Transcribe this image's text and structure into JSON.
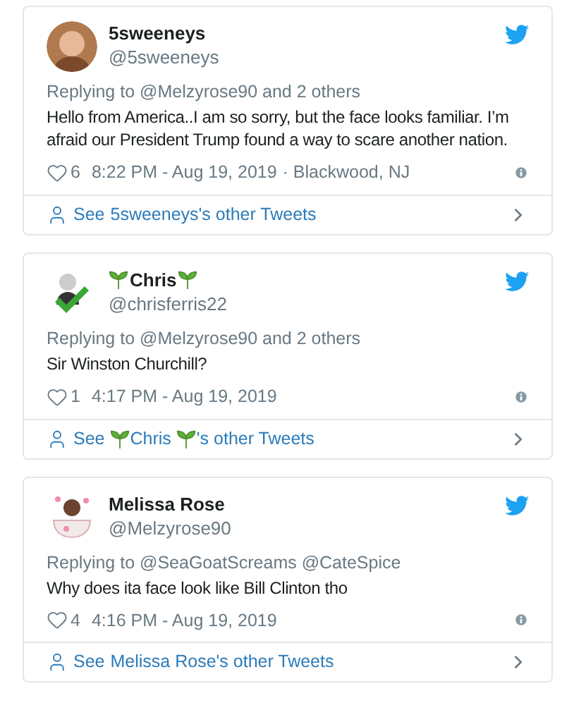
{
  "tweets": [
    {
      "avatar": {
        "kind": "photo"
      },
      "name": "5sweeneys",
      "decorated": false,
      "handle": "@5sweeneys",
      "replying_to": "Replying to @Melzyrose90 and 2 others",
      "text": "Hello from America..I am so sorry, but the face looks familiar. I’m afraid our President Trump found a way to scare another nation.",
      "likes": "6",
      "time": "8:22 PM - Aug 19, 2019",
      "location": "· Blackwood, NJ",
      "footer": {
        "prefix": "See",
        "name": "5sweeneys",
        "suffix": "'s other Tweets"
      }
    },
    {
      "avatar": {
        "kind": "checkmark"
      },
      "name": "Chris",
      "decorated": true,
      "handle": "@chrisferris22",
      "replying_to": "Replying to @Melzyrose90 and 2 others",
      "text": "Sir Winston Churchill?",
      "likes": "1",
      "time": "4:17 PM - Aug 19, 2019",
      "footer": {
        "prefix": "See",
        "name": "Chris",
        "suffix": "'s other Tweets"
      }
    },
    {
      "avatar": {
        "kind": "teacup"
      },
      "name": "Melissa Rose",
      "decorated": false,
      "handle": "@Melzyrose90",
      "replying_to": "Replying to @SeaGoatScreams @CateSpice",
      "text": "Why does ita face look like Bill Clinton tho",
      "likes": "4",
      "time": "4:16 PM - Aug 19, 2019",
      "footer": {
        "prefix": "See",
        "name": "Melissa Rose",
        "suffix": "'s other Tweets"
      }
    }
  ]
}
